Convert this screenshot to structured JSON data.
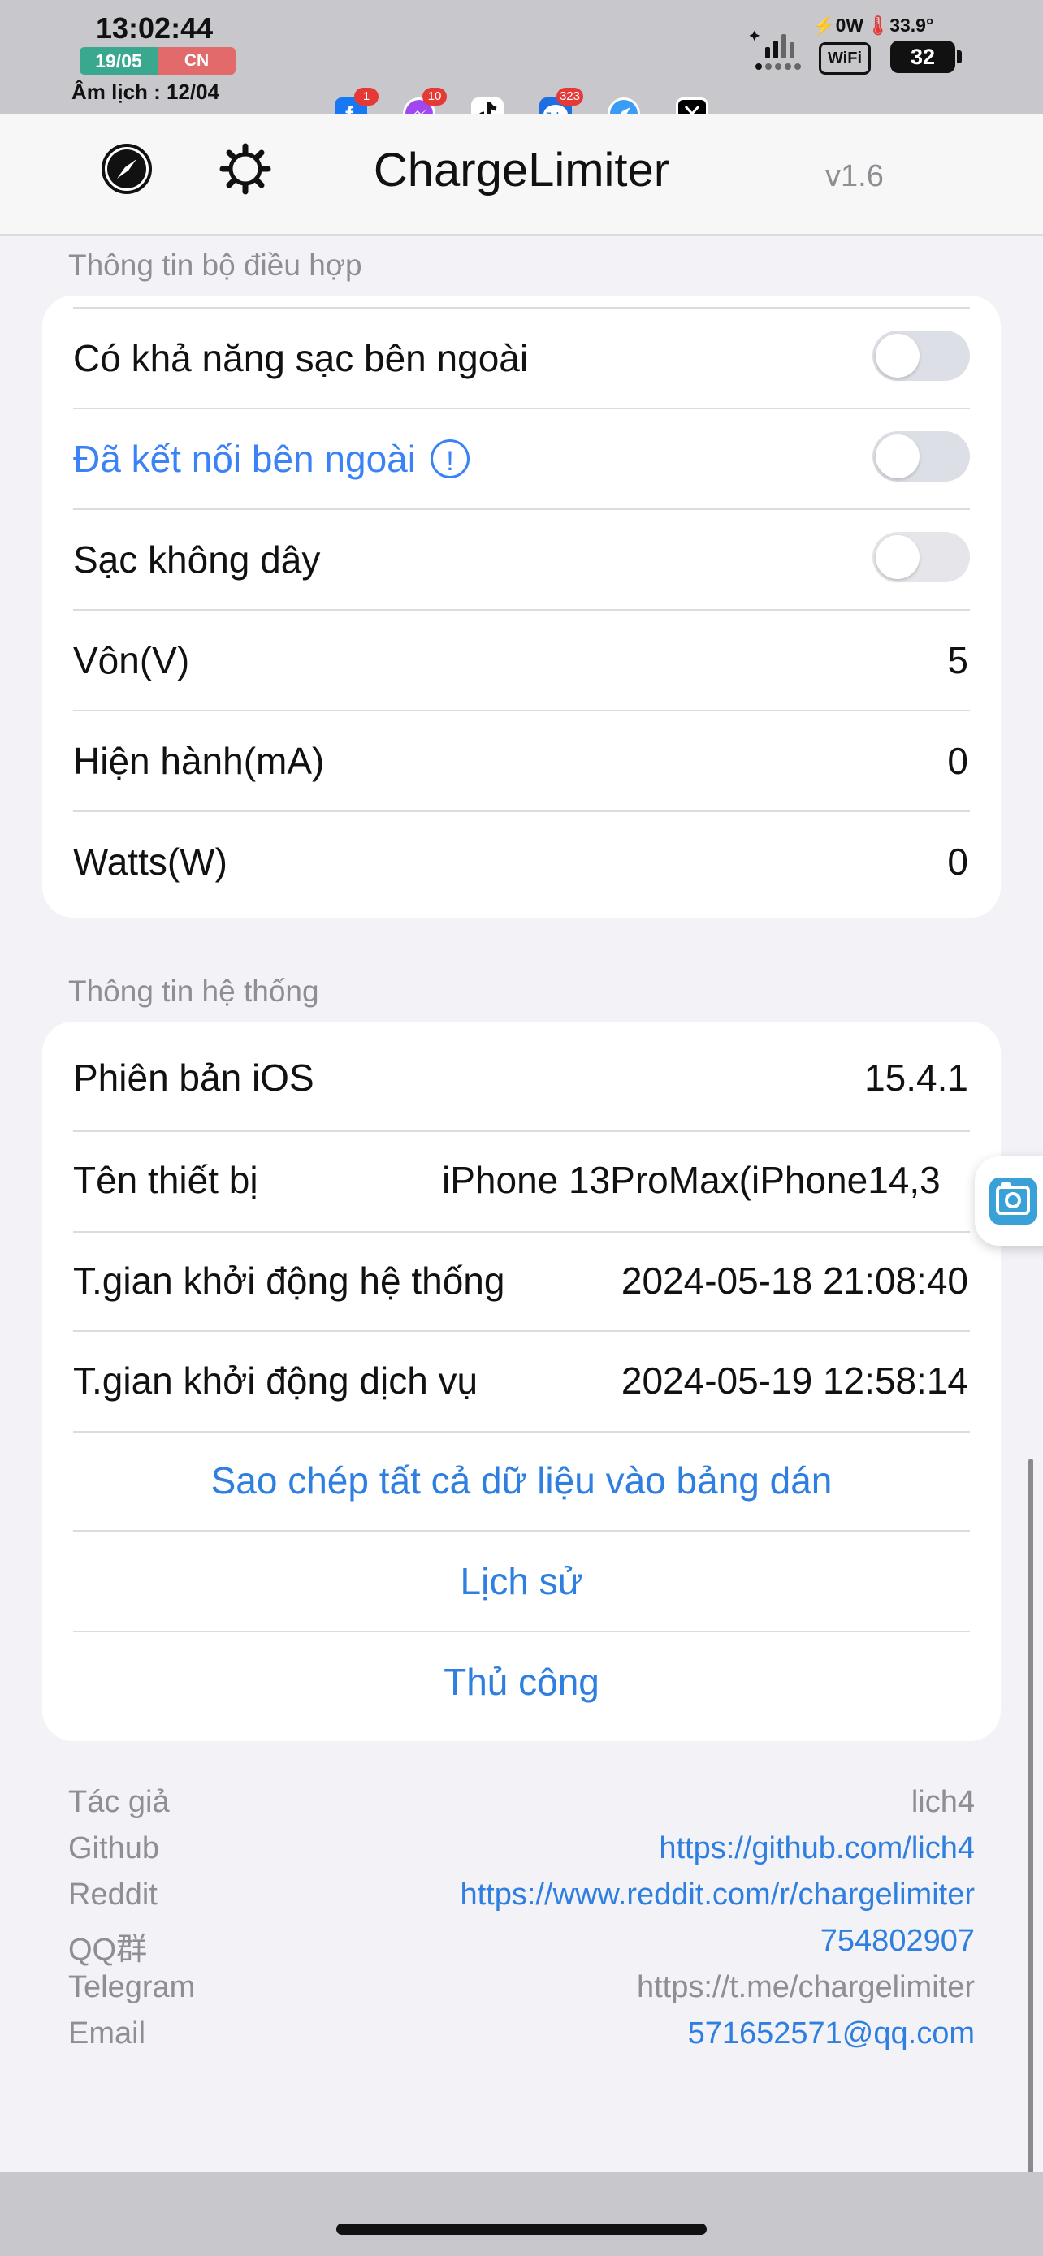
{
  "status_bar": {
    "time": "13:02:44",
    "date": "19/05",
    "weekday": "CN",
    "lunar": "Âm lịch : 12/04",
    "power": "0W",
    "temperature": "33.9°",
    "wifi_label": "WiFi",
    "battery": "32",
    "notification_apps": [
      {
        "icon": "facebook-icon",
        "badge": "1"
      },
      {
        "icon": "messenger-icon",
        "badge": "10"
      },
      {
        "icon": "tiktok-icon",
        "badge": ""
      },
      {
        "icon": "zalo-icon",
        "badge": "323"
      },
      {
        "icon": "safari-icon",
        "badge": ""
      },
      {
        "icon": "x-icon",
        "badge": ""
      }
    ]
  },
  "nav": {
    "title": "ChargeLimiter",
    "version": "v1.6",
    "left_icons": [
      "compass-icon",
      "gear-icon"
    ]
  },
  "adapter_section": {
    "header": "Thông tin bộ điều hợp",
    "rows": [
      {
        "label": "Có khả năng sạc bên ngoài",
        "toggle": false
      },
      {
        "label": "Đã kết nối bên ngoài",
        "toggle": false,
        "info_glyph": "!"
      },
      {
        "label": "Sạc không dây",
        "toggle": false
      },
      {
        "label": "Vôn(V)",
        "value": "5"
      },
      {
        "label": "Hiện hành(mA)",
        "value": "0"
      },
      {
        "label": "Watts(W)",
        "value": "0"
      }
    ]
  },
  "system_section": {
    "header": "Thông tin hệ thống",
    "rows": [
      {
        "label": "Phiên bản iOS",
        "value": "15.4.1"
      },
      {
        "label": "Tên thiết bị",
        "value": "iPhone 13ProMax(iPhone14,3"
      },
      {
        "label": "T.gian khởi động hệ thống",
        "value": "2024-05-18 21:08:40"
      },
      {
        "label": "T.gian khởi động dịch vụ",
        "value": "2024-05-19 12:58:14"
      }
    ],
    "buttons": [
      {
        "label": "Sao chép tất cả dữ liệu vào bảng dán"
      },
      {
        "label": "Lịch sử"
      },
      {
        "label": "Thủ công"
      }
    ]
  },
  "footer": [
    {
      "key": "Tác giả",
      "value": "lich4",
      "link": false
    },
    {
      "key": "Github",
      "value": "https://github.com/lich4",
      "link": true
    },
    {
      "key": "Reddit",
      "value": "https://www.reddit.com/r/chargelimiter",
      "link": true
    },
    {
      "key": "QQ群",
      "value": "754802907",
      "link": true
    },
    {
      "key": "Telegram",
      "value": "https://t.me/chargelimiter",
      "link": false
    },
    {
      "key": "Email",
      "value": "571652571@qq.com",
      "link": true
    }
  ],
  "colors": {
    "accent": "#2f7fe0",
    "background": "#f2f2f7",
    "secondary_text": "#8e8e93"
  }
}
